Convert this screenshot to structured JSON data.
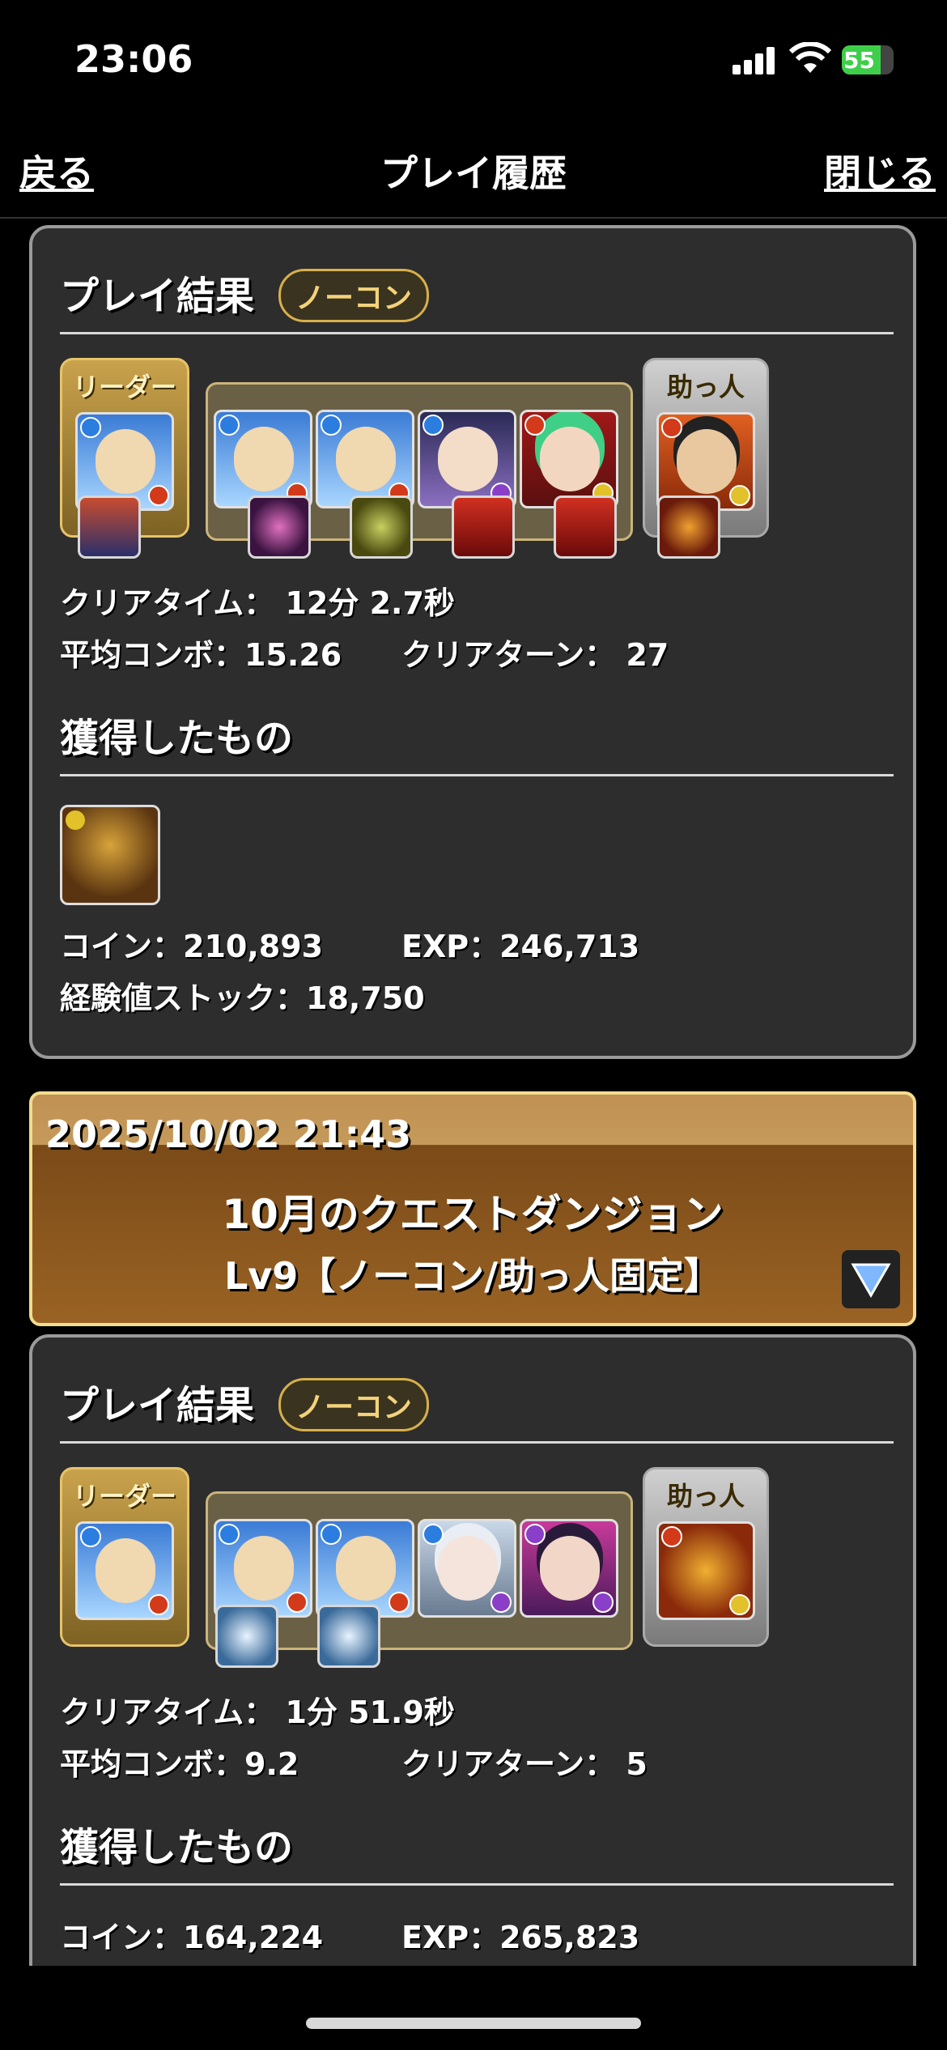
{
  "status_bar": {
    "time": "23:06",
    "battery": "55"
  },
  "nav": {
    "back_label": "戻る",
    "title": "プレイ履歴",
    "close_label": "閉じる"
  },
  "entries": [
    {
      "result_title": "プレイ結果",
      "badge": "ノーコン",
      "leader_label": "リーダー",
      "helper_label": "助っ人",
      "clear_time_label": "クリアタイム：",
      "clear_time": "12分 2.7秒",
      "avg_combo_label": "平均コンボ：",
      "avg_combo": "15.26",
      "clear_turn_label": "クリアターン：",
      "clear_turn": "27",
      "obtained_title": "獲得したもの",
      "coin_label": "コイン：",
      "coin": "210,893",
      "exp_label": "EXP：",
      "exp": "246,713",
      "stock_label": "経験値ストック：",
      "stock": "18,750"
    },
    {
      "result_title": "プレイ結果",
      "badge": "ノーコン",
      "leader_label": "リーダー",
      "helper_label": "助っ人",
      "clear_time_label": "クリアタイム：",
      "clear_time": "1分 51.9秒",
      "avg_combo_label": "平均コンボ：",
      "avg_combo": "9.2",
      "clear_turn_label": "クリアターン：",
      "clear_turn": "5",
      "obtained_title": "獲得したもの",
      "coin_label": "コイン：",
      "coin": "164,224",
      "exp_label": "EXP：",
      "exp": "265,823"
    }
  ],
  "dungeon": {
    "date": "2025/10/02 21:43",
    "name": "10月のクエストダンジョン",
    "floor": "Lv9【ノーコン/助っ人固定】"
  },
  "colors": {
    "card_bg": "#2d2d2d",
    "gold": "#d7b04a",
    "dungeon_brown": "#8a5a20"
  }
}
